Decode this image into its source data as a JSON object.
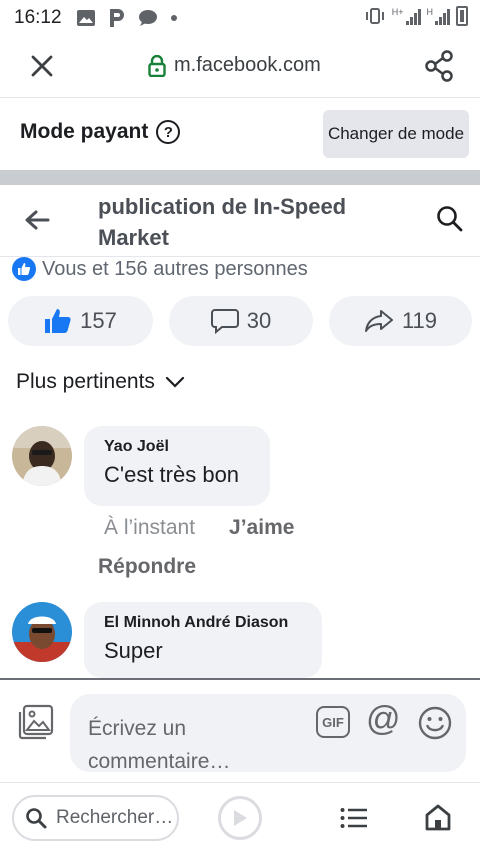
{
  "statusbar": {
    "time": "16:12",
    "icons": [
      "image-icon",
      "p-icon",
      "chat-bubble-icon",
      "dot-icon",
      "vibrate-icon",
      "signal-h-plus-icon",
      "signal-h-icon",
      "signal-icon",
      "battery-icon"
    ],
    "network_labels": [
      "H+",
      "H"
    ]
  },
  "browser": {
    "url": "m.facebook.com",
    "search_placeholder": "Rechercher…"
  },
  "mode": {
    "title": "Mode payant",
    "help_symbol": "?",
    "change_label": "Changer de mode"
  },
  "post": {
    "title": "publication de In-Speed Market",
    "reactions_text": "Vous et 156 autres personnes",
    "likes": "157",
    "comments": "30",
    "shares": "119",
    "sort_label": "Plus pertinents"
  },
  "comments": [
    {
      "author": "Yao Joël",
      "text": "C'est très bon",
      "time": "À l’instant",
      "like_label": "J’aime",
      "reply_label": "Répondre"
    },
    {
      "author": "El Minnoh André Diason",
      "text": "Super"
    }
  ],
  "composer": {
    "placeholder": "Écrivez un commentaire…",
    "gif_label": "GIF",
    "at_symbol": "@"
  },
  "colors": {
    "facebook_blue": "#1877f2",
    "bubble_bg": "#f0f2f5",
    "secure_green": "#188038"
  }
}
